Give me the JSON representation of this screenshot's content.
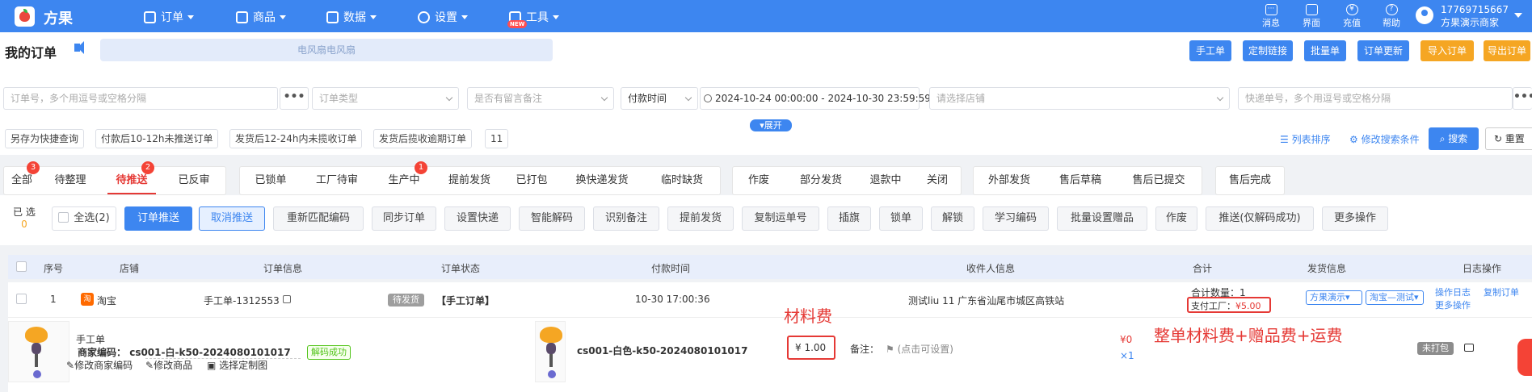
{
  "nav": {
    "brand": "方果",
    "menu": [
      "订单",
      "商品",
      "数据",
      "设置",
      "工具"
    ],
    "new_badge": "NEW",
    "tools": [
      {
        "label": "消息",
        "icon": "message-icon"
      },
      {
        "label": "界面",
        "icon": "shirt-icon"
      },
      {
        "label": "充值",
        "icon": "yen-icon"
      },
      {
        "label": "帮助",
        "icon": "help-icon"
      }
    ],
    "account_phone": "17769715667",
    "account_name": "方果演示商家"
  },
  "page": {
    "title": "我的订单",
    "announcement": "电风扇电风扇",
    "top_buttons": [
      {
        "label": "手工单",
        "color": "#3d86f0"
      },
      {
        "label": "定制链接",
        "color": "#3d86f0"
      },
      {
        "label": "批量单",
        "color": "#3d86f0"
      },
      {
        "label": "订单更新",
        "color": "#3d86f0"
      },
      {
        "label": "导入订单",
        "color": "#f5a623"
      },
      {
        "label": "导出订单",
        "color": "#f5a623"
      }
    ]
  },
  "filters": {
    "order_no_placeholder": "订单号，多个用逗号或空格分隔",
    "order_type_placeholder": "订单类型",
    "remark_placeholder": "是否有留言备注",
    "time_type": "付款时间",
    "date_start": "2024-10-24 00:00:00",
    "date_sep": "-",
    "date_end": "2024-10-30 23:59:59",
    "shop_placeholder": "请选择店铺",
    "express_placeholder": "快递单号，多个用逗号或空格分隔",
    "dots": "•••",
    "quick": [
      "另存为快捷查询",
      "付款后10-12h未推送订单",
      "发货后12-24h内未揽收订单",
      "发货后揽收逾期订单",
      "11"
    ],
    "expand": "展开",
    "list_sort": "列表排序",
    "edit_conditions": "修改搜索条件",
    "search": "搜索",
    "reset": "重置"
  },
  "tab_groups": [
    [
      {
        "label": "全部",
        "badge": "3"
      },
      {
        "label": "待整理"
      },
      {
        "label": "待推送",
        "badge": "2",
        "active": true
      },
      {
        "label": "已反审"
      }
    ],
    [
      {
        "label": "已锁单"
      },
      {
        "label": "工厂待审"
      },
      {
        "label": "生产中",
        "badge": "1"
      },
      {
        "label": "提前发货"
      },
      {
        "label": "已打包"
      },
      {
        "label": "换快递发货"
      },
      {
        "label": "临时缺货"
      }
    ],
    [
      {
        "label": "作废"
      },
      {
        "label": "部分发货"
      },
      {
        "label": "退款中"
      },
      {
        "label": "关闭"
      }
    ],
    [
      {
        "label": "外部发货"
      },
      {
        "label": "售后草稿"
      },
      {
        "label": "售后已提交"
      }
    ],
    [
      {
        "label": "售后完成"
      }
    ]
  ],
  "actions": {
    "selected_label": "已 选",
    "selected_count": "0",
    "select_all": "全选(2)",
    "push": "订单推送",
    "cancel_push": "取消推送",
    "buttons": [
      "重新匹配编码",
      "同步订单",
      "设置快递",
      "智能解码",
      "识别备注",
      "提前发货",
      "复制运单号",
      "插旗",
      "锁单",
      "解锁",
      "学习编码",
      "批量设置赠品",
      "作废",
      "推送(仅解码成功)",
      "更多操作"
    ]
  },
  "table": {
    "headers": [
      "序号",
      "店铺",
      "订单信息",
      "订单状态",
      "付款时间",
      "收件人信息",
      "合计",
      "发货信息",
      "日志操作"
    ],
    "order": {
      "index": "1",
      "shop": "淘宝",
      "shop_icon": "淘",
      "order_info": "手工单-1312553",
      "status": "待发货",
      "order_type": "【手工订单】",
      "pay_time": "10-30 17:00:36",
      "recipient": "测试liu 11 广东省汕尾市城区高铁站",
      "total_qty": "合计数量：1",
      "pay_factory_label": "支付工厂：",
      "pay_factory_value": "¥5.00",
      "ship_sel_1": "方果演示",
      "ship_sel_2": "淘宝—测试",
      "op_log": "操作日志",
      "copy_order": "复制订单",
      "more_ops": "更多操作"
    },
    "item": {
      "title": "手工单",
      "merchant_code_label": "商家编码：",
      "merchant_code": "cs001-白-k50-2024080101017",
      "decode_status": "解码成功",
      "edit_code": "修改商家编码",
      "edit_product": "修改商品",
      "choose_image": "选择定制图",
      "sku": "cs001-白色-k50-2024080101017",
      "material_fee": "¥ 1.00",
      "remark_label": "备注：",
      "remark_hint": "(点击可设置)",
      "price": "¥0",
      "qty": "×1",
      "pack_status": "未打包"
    }
  },
  "annotations": {
    "material": "材料费",
    "total": "整单材料费+赠品费+运费"
  }
}
